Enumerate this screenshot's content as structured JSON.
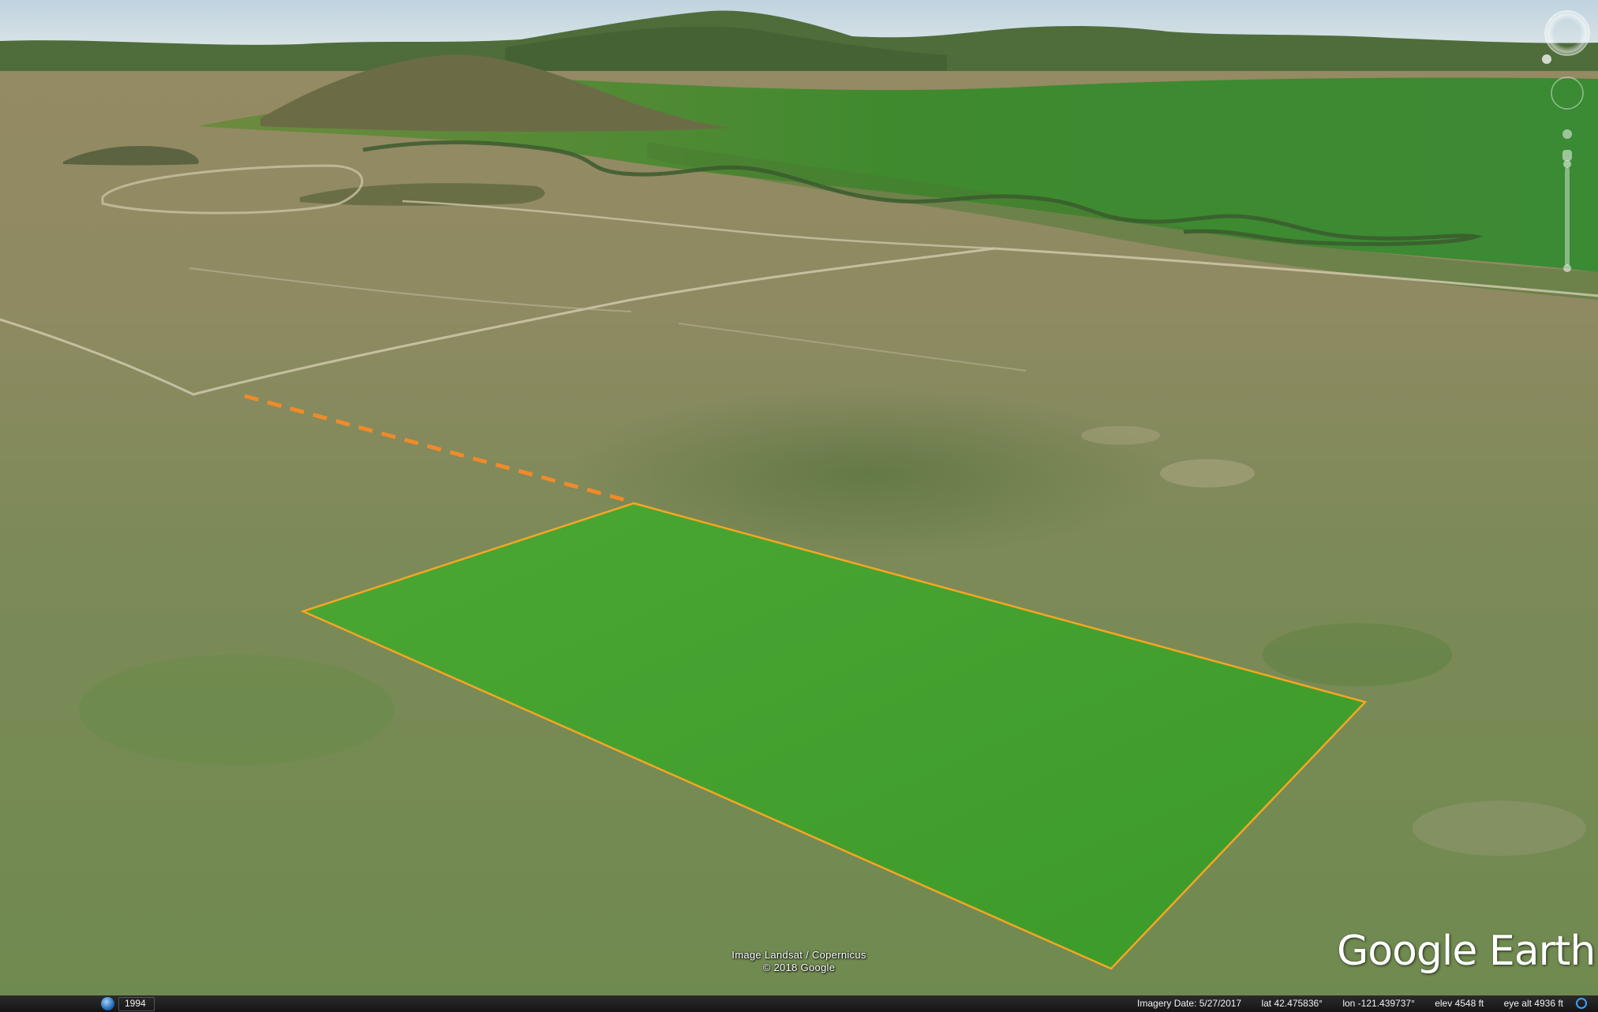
{
  "attribution": {
    "line1": "Image Landsat / Copernicus",
    "line2": "© 2018 Google"
  },
  "logo": "Google Earth",
  "status_bar": {
    "historical_year": "1994",
    "imagery_date": "Imagery Date: 5/27/2017",
    "lat": "lat   42.475836°",
    "lon": "lon -121.439737°",
    "elev": "elev  4548 ft",
    "eye_alt": "eye alt   4936 ft"
  },
  "colors": {
    "parcel_outline": "#f5a623",
    "parcel_fill": "#3fa02a",
    "access_line": "#f08a2a",
    "statusbar_bg": "#1c1c1c"
  },
  "icons": [
    "compass-icon",
    "north-indicator-icon",
    "look-joystick-icon",
    "move-joystick-icon",
    "street-view-pegman-icon",
    "zoom-slider-icon",
    "historical-imagery-icon",
    "streaming-indicator-icon"
  ]
}
